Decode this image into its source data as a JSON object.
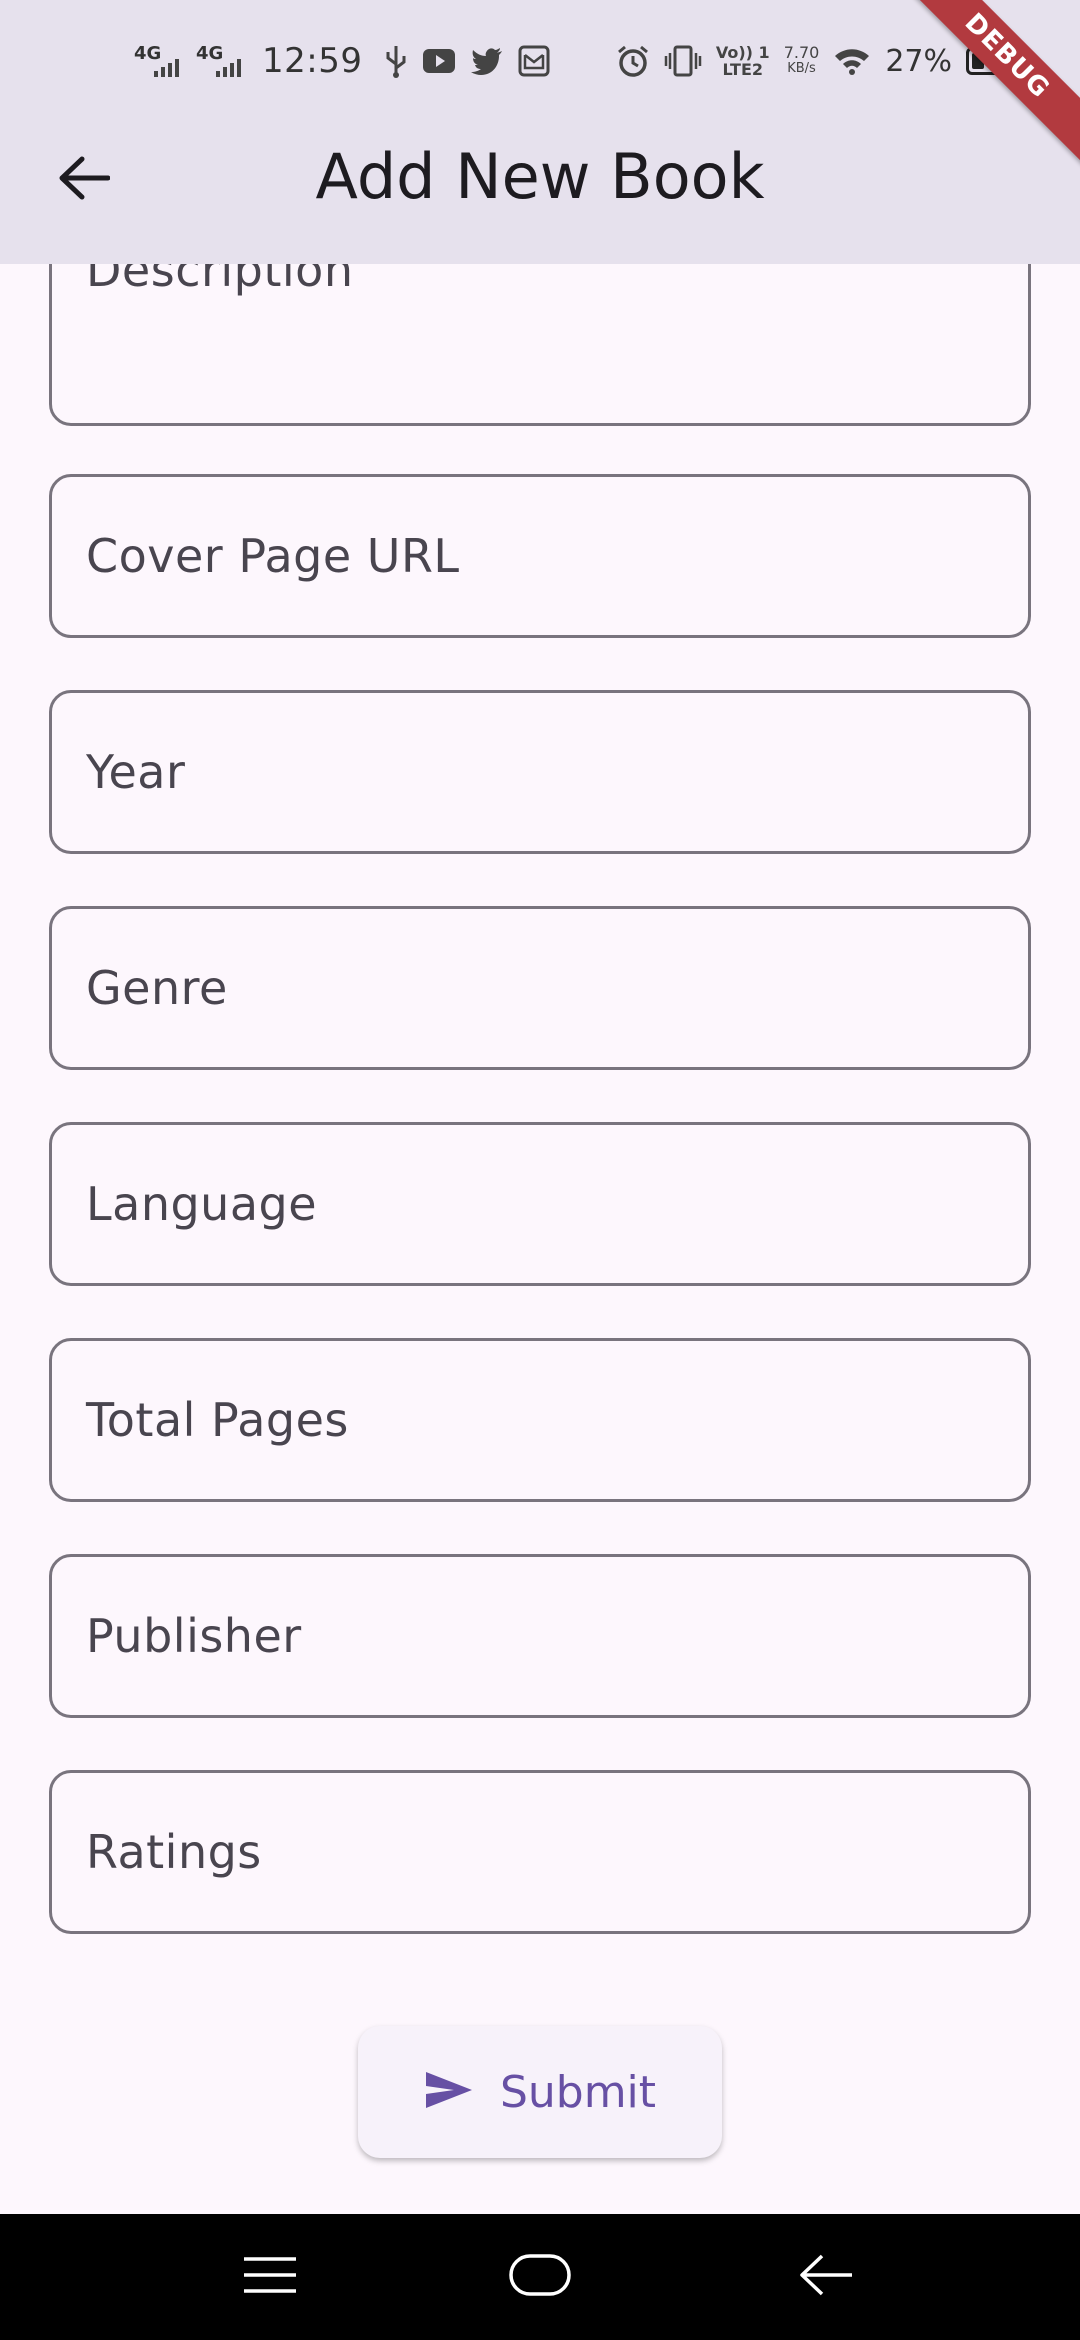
{
  "status_bar": {
    "network_1": "4G",
    "network_2": "4G",
    "time": "12:59",
    "volte": "Vo)) 1",
    "lte": "LTE2",
    "speed_value": "7.70",
    "speed_unit": "KB/s",
    "battery": "27%",
    "battery_level": 0.27,
    "icons": [
      "usb-icon",
      "youtube-icon",
      "twitter-icon",
      "message-icon",
      "alarm-icon",
      "vibrate-icon",
      "wifi-icon",
      "battery-icon"
    ]
  },
  "debug_banner": "DEBUG",
  "app_bar": {
    "back_icon": "arrow-left-icon",
    "title": "Add New Book"
  },
  "form": {
    "fields": [
      {
        "id": "description",
        "placeholder": "Description"
      },
      {
        "id": "cover_page_url",
        "placeholder": "Cover Page URL"
      },
      {
        "id": "year",
        "placeholder": "Year"
      },
      {
        "id": "genre",
        "placeholder": "Genre"
      },
      {
        "id": "language",
        "placeholder": "Language"
      },
      {
        "id": "total_pages",
        "placeholder": "Total Pages"
      },
      {
        "id": "publisher",
        "placeholder": "Publisher"
      },
      {
        "id": "ratings",
        "placeholder": "Ratings"
      }
    ],
    "submit": {
      "label": "Submit",
      "icon": "send-icon"
    }
  },
  "nav_bar": {
    "icons": [
      "menu-icon",
      "home-icon",
      "back-icon"
    ]
  },
  "colors": {
    "background": "#FDF7FD",
    "app_bar": "#E6E1ED",
    "outline": "#79747E",
    "accent": "#6750A4",
    "debug": "#B23A3F"
  }
}
